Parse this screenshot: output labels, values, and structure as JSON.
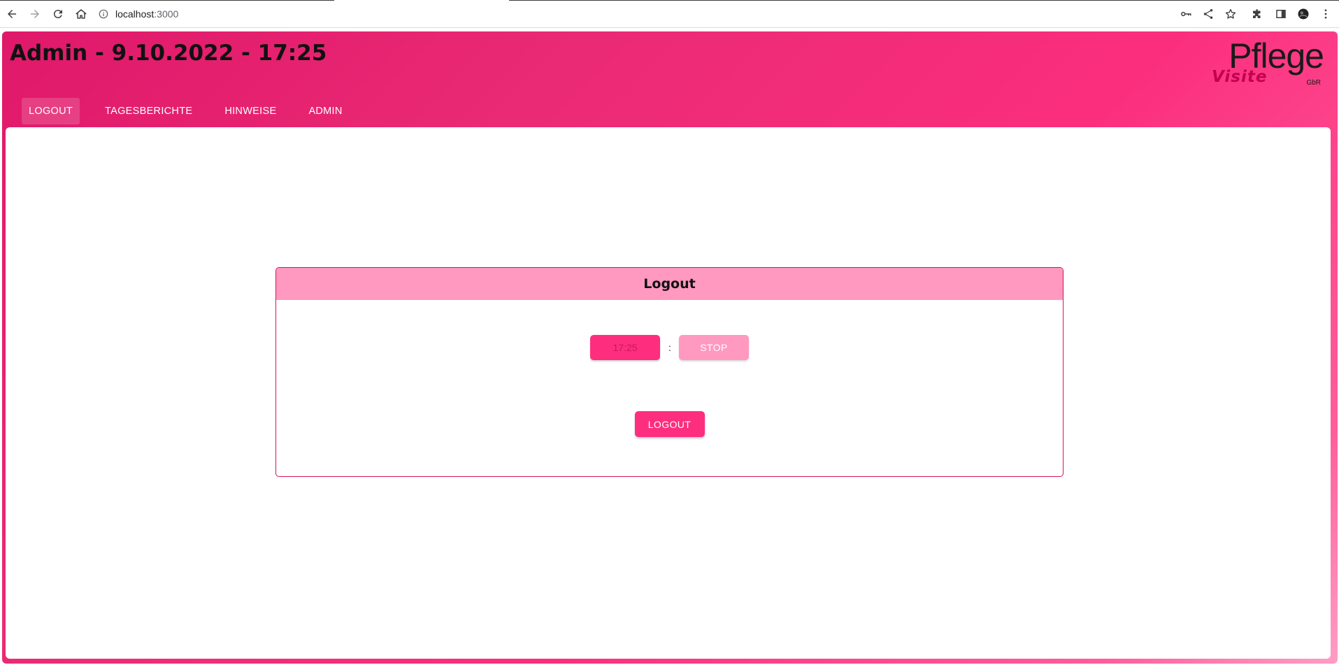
{
  "browser": {
    "url_host": "localhost",
    "url_port": ":3000",
    "icons": [
      "back-icon",
      "forward-icon",
      "reload-icon",
      "home-icon",
      "info-icon",
      "key-icon",
      "share-icon",
      "star-icon",
      "extensions-icon",
      "side-panel-icon",
      "profile-avatar",
      "menu-icon"
    ]
  },
  "app": {
    "title": "Admin - 9.10.2022 - 17:25",
    "logo": {
      "line1": "Pflege",
      "line2": "Visite",
      "suffix": "GbR"
    },
    "nav": [
      {
        "label": "LOGOUT",
        "active": true
      },
      {
        "label": "TAGESBERICHTE",
        "active": false
      },
      {
        "label": "HINWEISE",
        "active": false
      },
      {
        "label": "ADMIN",
        "active": false
      }
    ],
    "colors": {
      "brand": "#fe2e7e",
      "brand_light": "#ff99c0",
      "border": "#d4145a"
    }
  },
  "panel": {
    "title": "Logout",
    "time_placeholder": "17:25",
    "separator": ":",
    "stop_label": "STOP",
    "logout_label": "LOGOUT"
  }
}
